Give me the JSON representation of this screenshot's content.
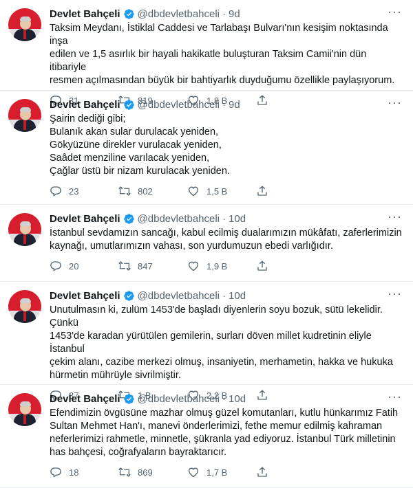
{
  "tweets": [
    {
      "name": "Devlet Bahçeli",
      "handle": "@dbdevletbahceli",
      "separator": "·",
      "time": "9d",
      "text": "Taksim Meydanı, İstiklal Caddesi ve Tarlabaşı Bulvarı'nın kesişim noktasında inşa\nedilen ve 1,5 asırlık bir hayali hakikatle buluşturan Taksim Camii'nin dün itibariyle\nresmen açılmasından büyük bir bahtiyarlık duyduğumu özellikle paylaşıyorum.",
      "replies": "31",
      "retweets": "819",
      "likes": "1,8 B"
    },
    {
      "name": "Devlet Bahçeli",
      "handle": "@dbdevletbahceli",
      "separator": "·",
      "time": "9d",
      "text": "Şairin dediği gibi;\nBulanık akan sular durulacak yeniden,\nGökyüzüne direkler vurulacak yeniden,\nSaâdet menziline varılacak yeniden,\nÇağlar üstü bir nizam kurulacak yeniden.",
      "replies": "23",
      "retweets": "802",
      "likes": "1,5 B"
    },
    {
      "name": "Devlet Bahçeli",
      "handle": "@dbdevletbahceli",
      "separator": "·",
      "time": "10d",
      "text": "İstanbul sevdamızın sancağı, kabul ecilmiş dualarımızın mükâfatı, zaferlerimizin\nkaynağı, umutlarımızın vahası, son yurdumuzun ebedi varlığıdır.",
      "replies": "20",
      "retweets": "847",
      "likes": "1,9 B"
    },
    {
      "name": "Devlet Bahçeli",
      "handle": "@dbdevletbahceli",
      "separator": "·",
      "time": "10d",
      "text": "Unutulmasın ki, zulüm 1453'de başladı diyenlerin soyu bozuk, sütü lekelidir. Çünkü\n1453'de karadan yürütülen gemilerin, surları döven millet kudretinin eliyle İstanbul\nçekim alanı, cazibe merkezi olmuş, insaniyetin, merhametin, hakka ve hukuka\nhürmetin mührüyle sivrilmiştir.",
      "replies": "37",
      "retweets": "1 B",
      "likes": "2,2 B"
    },
    {
      "name": "Devlet Bahçeli",
      "handle": "@dbdevletbahceli",
      "separator": "·",
      "time": "10d",
      "text": "Efendimizin övgüsüne mazhar olmuş güzel komutanları, kutlu hünkarımız Fatih\nSultan Mehmet Han'ı, manevi önderlerimizi, fethe memur edilmiş kahraman\nneferlerimizi rahmetle, minnetle, şükranla yad ediyoruz. İstanbul Türk milletinin\nhas bahçesi, coğrafyaların bayraktarıcır.",
      "replies": "18",
      "retweets": "869",
      "likes": "1,7 B"
    }
  ],
  "colors": {
    "verified": "#1d9bf0",
    "secondary_text": "#536471",
    "divider": "#e6ecf0"
  },
  "icons": {
    "reply": "reply-icon",
    "retweet": "retweet-icon",
    "like": "heart-icon",
    "share": "share-icon",
    "more": "more-icon",
    "verified": "verified-badge-icon"
  }
}
